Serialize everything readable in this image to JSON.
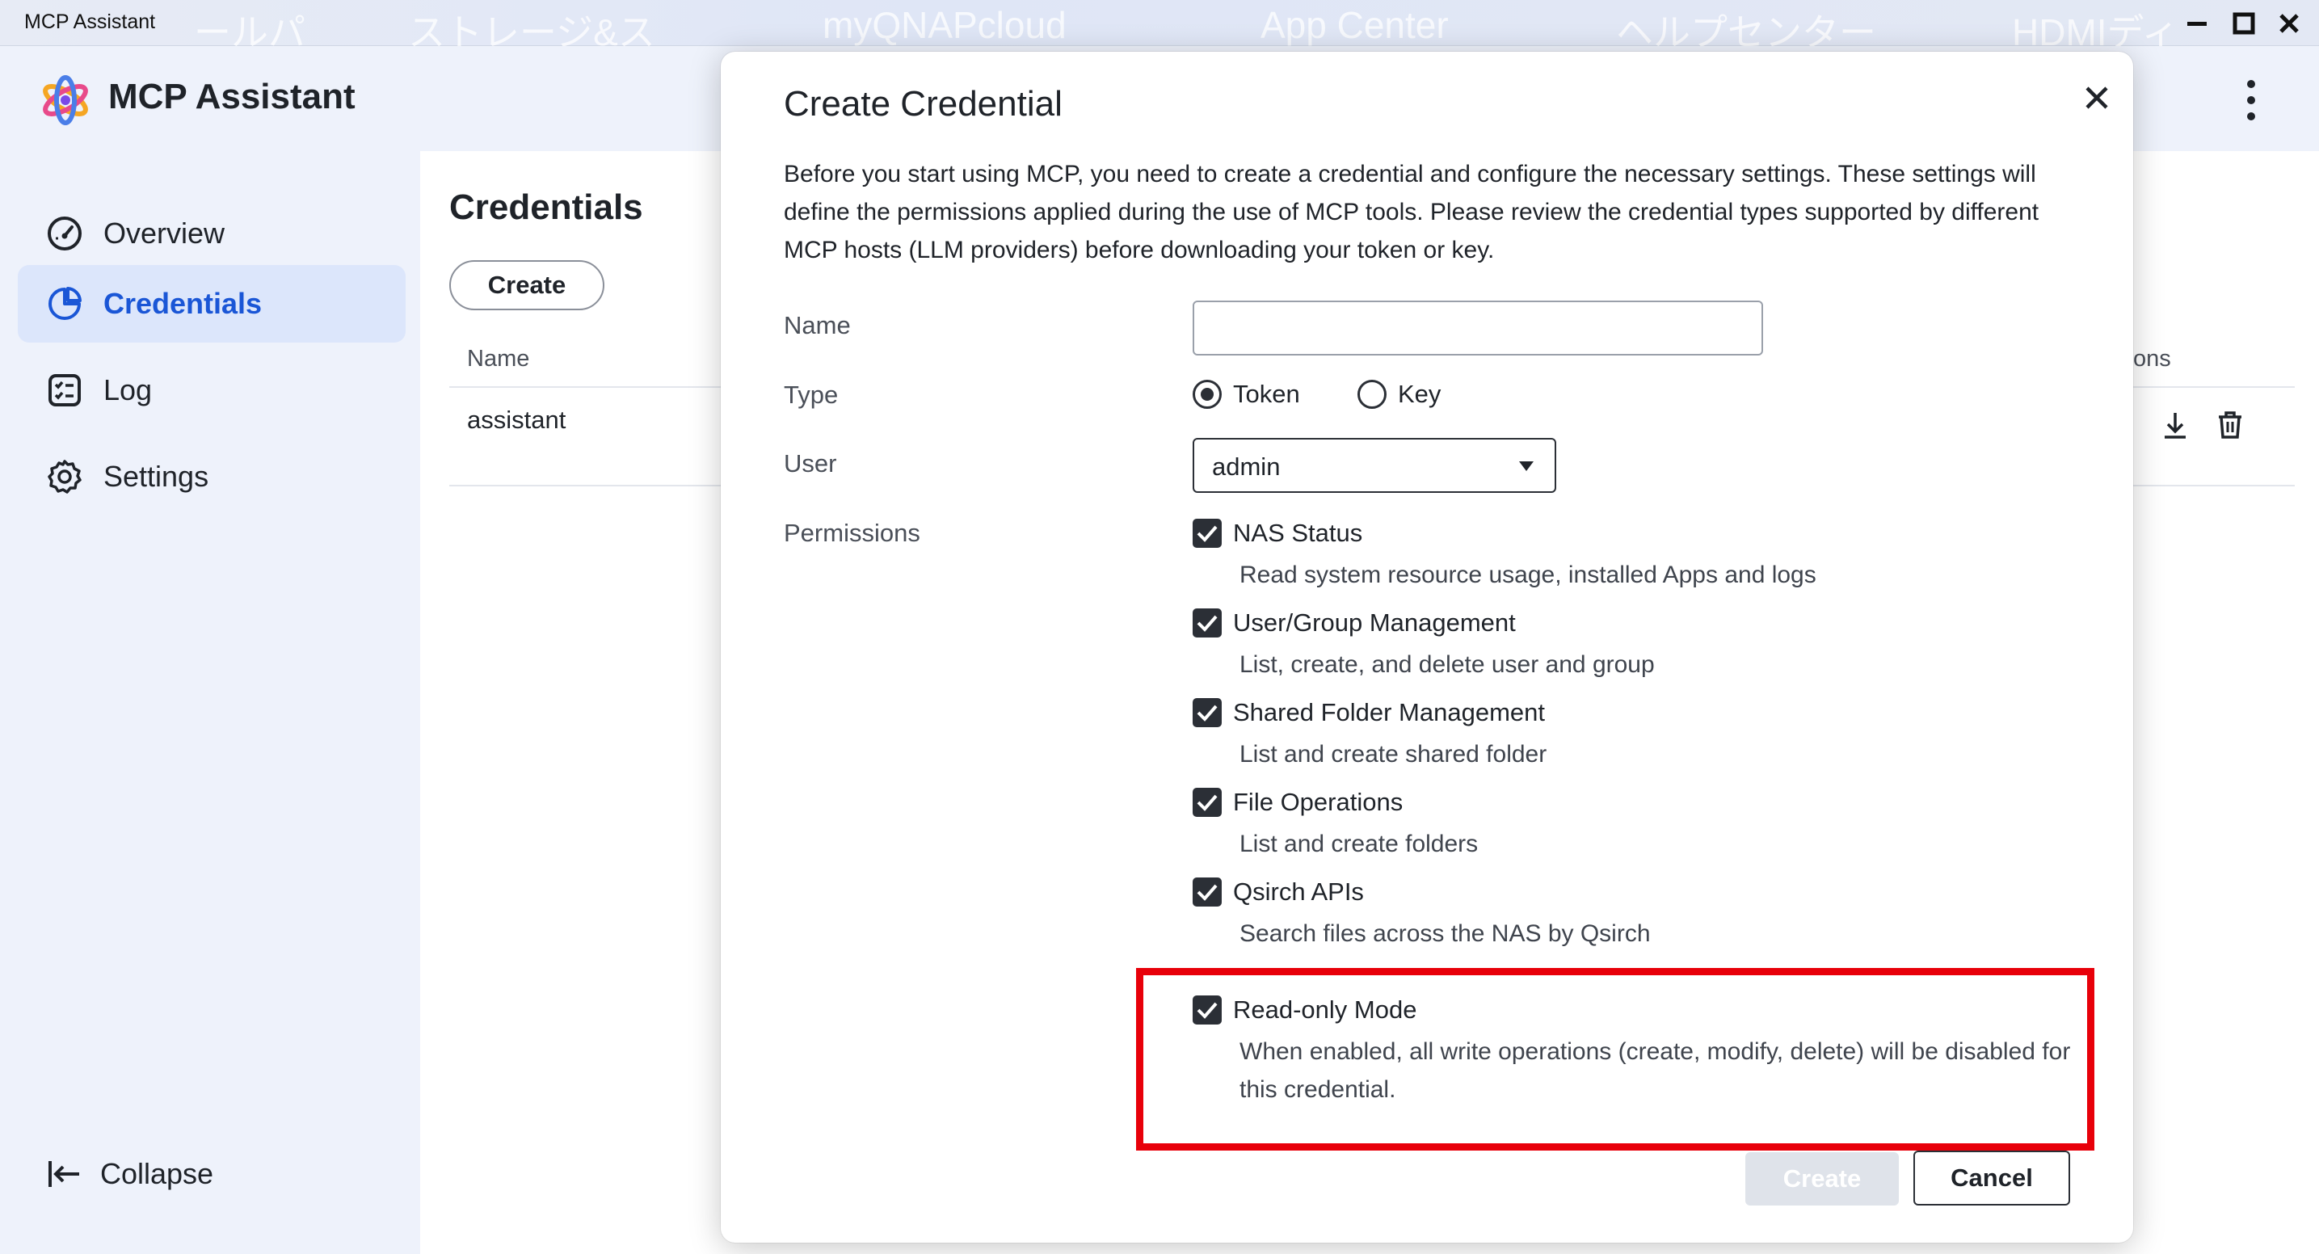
{
  "window": {
    "title": "MCP Assistant",
    "background_labels": [
      "ールパ",
      "ストレージ&ス",
      "myQNAPcloud",
      "App Center",
      "ヘルプセンター",
      "HDMIディ"
    ]
  },
  "app": {
    "name": "MCP Assistant"
  },
  "sidebar": {
    "items": [
      {
        "label": "Overview",
        "icon": "gauge-icon"
      },
      {
        "label": "Credentials",
        "icon": "pie-chart-icon",
        "active": true
      },
      {
        "label": "Log",
        "icon": "log-list-icon"
      },
      {
        "label": "Settings",
        "icon": "gear-icon"
      }
    ],
    "collapse_label": "Collapse"
  },
  "page": {
    "title": "Credentials",
    "create_label": "Create",
    "columns": {
      "name": "Name",
      "actions_partial": "ons"
    },
    "rows": [
      {
        "name": "assistant"
      }
    ]
  },
  "modal": {
    "title": "Create Credential",
    "description": "Before you start using MCP, you need to create a credential and configure the necessary settings. These settings will define the permissions applied during the use of MCP tools. Please review the credential types supported by different MCP hosts (LLM providers) before downloading your token or key.",
    "fields": {
      "name_label": "Name",
      "name_value": "",
      "type_label": "Type",
      "type_options": [
        "Token",
        "Key"
      ],
      "type_selected": "Token",
      "user_label": "User",
      "user_value": "admin",
      "permissions_label": "Permissions"
    },
    "permissions": [
      {
        "title": "NAS Status",
        "desc": "Read system resource usage, installed Apps and logs",
        "checked": true
      },
      {
        "title": "User/Group Management",
        "desc": "List, create, and delete user and group",
        "checked": true
      },
      {
        "title": "Shared Folder Management",
        "desc": "List and create shared folder",
        "checked": true
      },
      {
        "title": "File Operations",
        "desc": "List and create folders",
        "checked": true
      },
      {
        "title": "Qsirch APIs",
        "desc": "Search files across the NAS by Qsirch",
        "checked": true
      },
      {
        "title": "Read-only Mode",
        "desc": "When enabled, all write operations (create, modify, delete) will be disabled for this credential.",
        "checked": true
      }
    ],
    "buttons": {
      "create": "Create",
      "cancel": "Cancel"
    }
  },
  "colors": {
    "accent": "#1a56d6",
    "sidebar_bg": "#eef2fb",
    "active_item_bg": "#dce6fb",
    "highlight_border": "#e8000a",
    "disabled_button": "#dfe3ea"
  }
}
